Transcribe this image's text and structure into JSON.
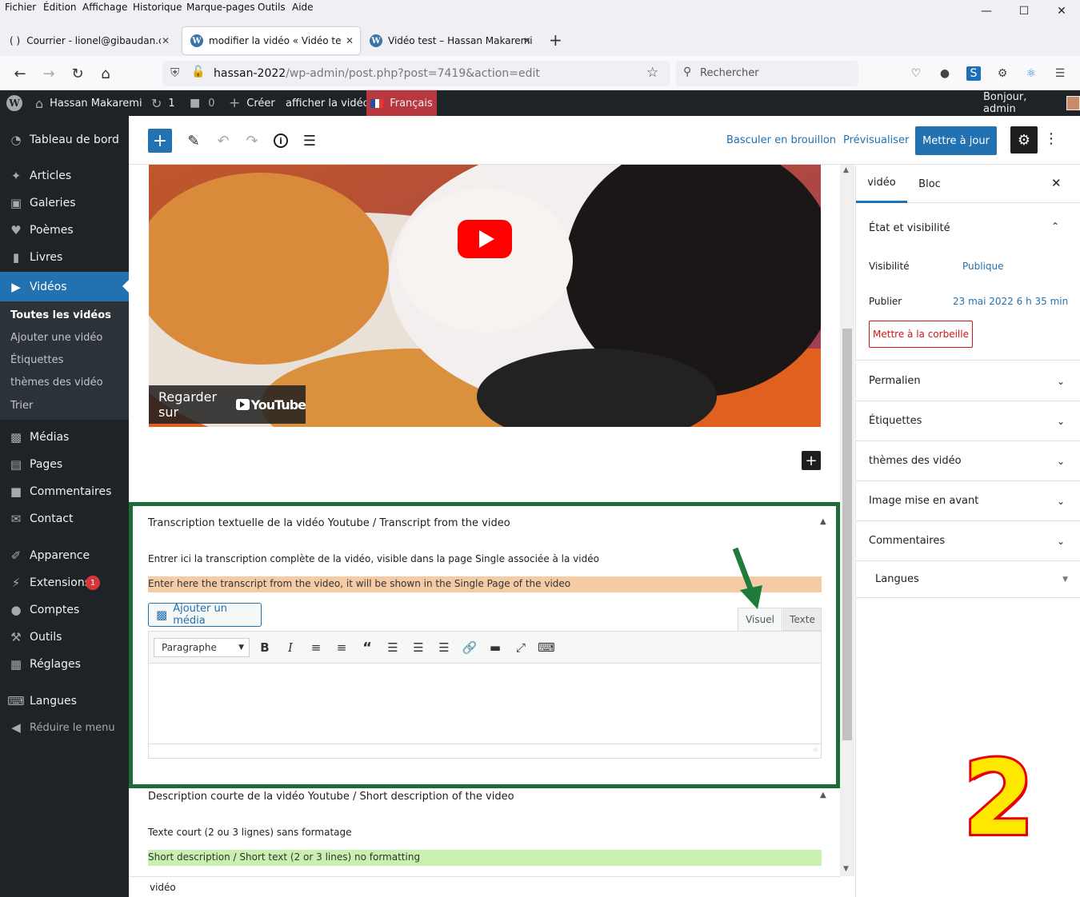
{
  "browser": {
    "menu": [
      "Fichier",
      "Édition",
      "Affichage",
      "Historique",
      "Marque-pages",
      "Outils",
      "Aide"
    ],
    "tabs": [
      {
        "label": "Courrier - lionel@gibaudan.con"
      },
      {
        "label": "modifier la vidéo « Vidéo test »"
      },
      {
        "label": "Vidéo test – Hassan Makaremi"
      }
    ],
    "url_domain": "hassan-2022",
    "url_path": "/wp-admin/post.php?post=7419&action=edit",
    "search_placeholder": "Rechercher"
  },
  "adminbar": {
    "site": "Hassan Makaremi",
    "updates": "1",
    "comments": "0",
    "create": "Créer",
    "view": "afficher la vidéo",
    "language": "Français",
    "greeting": "Bonjour, admin"
  },
  "menu": {
    "items": [
      {
        "label": "Tableau de bord",
        "icon": "dashboard-icon"
      },
      {
        "label": "Articles",
        "icon": "pin-icon"
      },
      {
        "label": "Galeries",
        "icon": "gallery-icon"
      },
      {
        "label": "Poèmes",
        "icon": "heart-icon"
      },
      {
        "label": "Livres",
        "icon": "book-icon"
      },
      {
        "label": "Vidéos",
        "icon": "video-icon"
      },
      {
        "label": "Médias",
        "icon": "media-icon"
      },
      {
        "label": "Pages",
        "icon": "pages-icon"
      },
      {
        "label": "Commentaires",
        "icon": "comments-icon"
      },
      {
        "label": "Contact",
        "icon": "mail-icon"
      },
      {
        "label": "Apparence",
        "icon": "brush-icon"
      },
      {
        "label": "Extensions",
        "icon": "plugin-icon"
      },
      {
        "label": "Comptes",
        "icon": "user-icon"
      },
      {
        "label": "Outils",
        "icon": "wrench-icon"
      },
      {
        "label": "Réglages",
        "icon": "settings-icon"
      },
      {
        "label": "Langues",
        "icon": "translate-icon"
      },
      {
        "label": "Réduire le menu",
        "icon": "collapse-icon"
      }
    ],
    "extensions_badge": "1",
    "submenu": [
      "Toutes les vidéos",
      "Ajouter une vidéo",
      "Étiquettes",
      "thèmes des vidéo",
      "Trier"
    ]
  },
  "editor": {
    "switch_draft": "Basculer en brouillon",
    "preview": "Prévisualiser",
    "update": "Mettre à jour"
  },
  "video": {
    "watch_on": "Regarder sur",
    "youtube": "YouTube"
  },
  "transcript_box": {
    "title": "Transcription textuelle de la vidéo Youtube / Transcript from the video",
    "description": "Entrer ici la transcription complète de la vidéo, visible dans la page Single associée à la vidéo",
    "hint": "Enter here the transcript from the video, it will be shown in the Single Page of the video",
    "add_media": "Ajouter un média",
    "tab_visual": "Visuel",
    "tab_text": "Texte",
    "format": "Paragraphe"
  },
  "short_box": {
    "title": "Description courte de la vidéo Youtube / Short description of the video",
    "description": "Texte court (2 ou 3 lignes) sans formatage",
    "hint": "Short description / Short text (2 or 3 lines) no formatting"
  },
  "footer_label": "vidéo",
  "sidebar": {
    "tab_doc": "vidéo",
    "tab_block": "Bloc",
    "status_title": "État et visibilité",
    "visibility_label": "Visibilité",
    "visibility_value": "Publique",
    "publish_label": "Publier",
    "publish_value": "23 mai 2022 6 h 35 min",
    "trash": "Mettre à la corbeille",
    "panels": [
      "Permalien",
      "Étiquettes",
      "thèmes des vidéo",
      "Image mise en avant",
      "Commentaires"
    ],
    "languages": "Langues"
  },
  "annotation_number": "2",
  "colors": {
    "wp_blue": "#2271b1",
    "admin_dark": "#1d2327",
    "highlight_orange": "#f5cba5",
    "highlight_green": "#c9f0b0",
    "frame_green": "#1e6b3a",
    "arrow_green": "#1e7b3a",
    "annotation_red": "#e8000b",
    "annotation_yellow": "#ffe800"
  }
}
